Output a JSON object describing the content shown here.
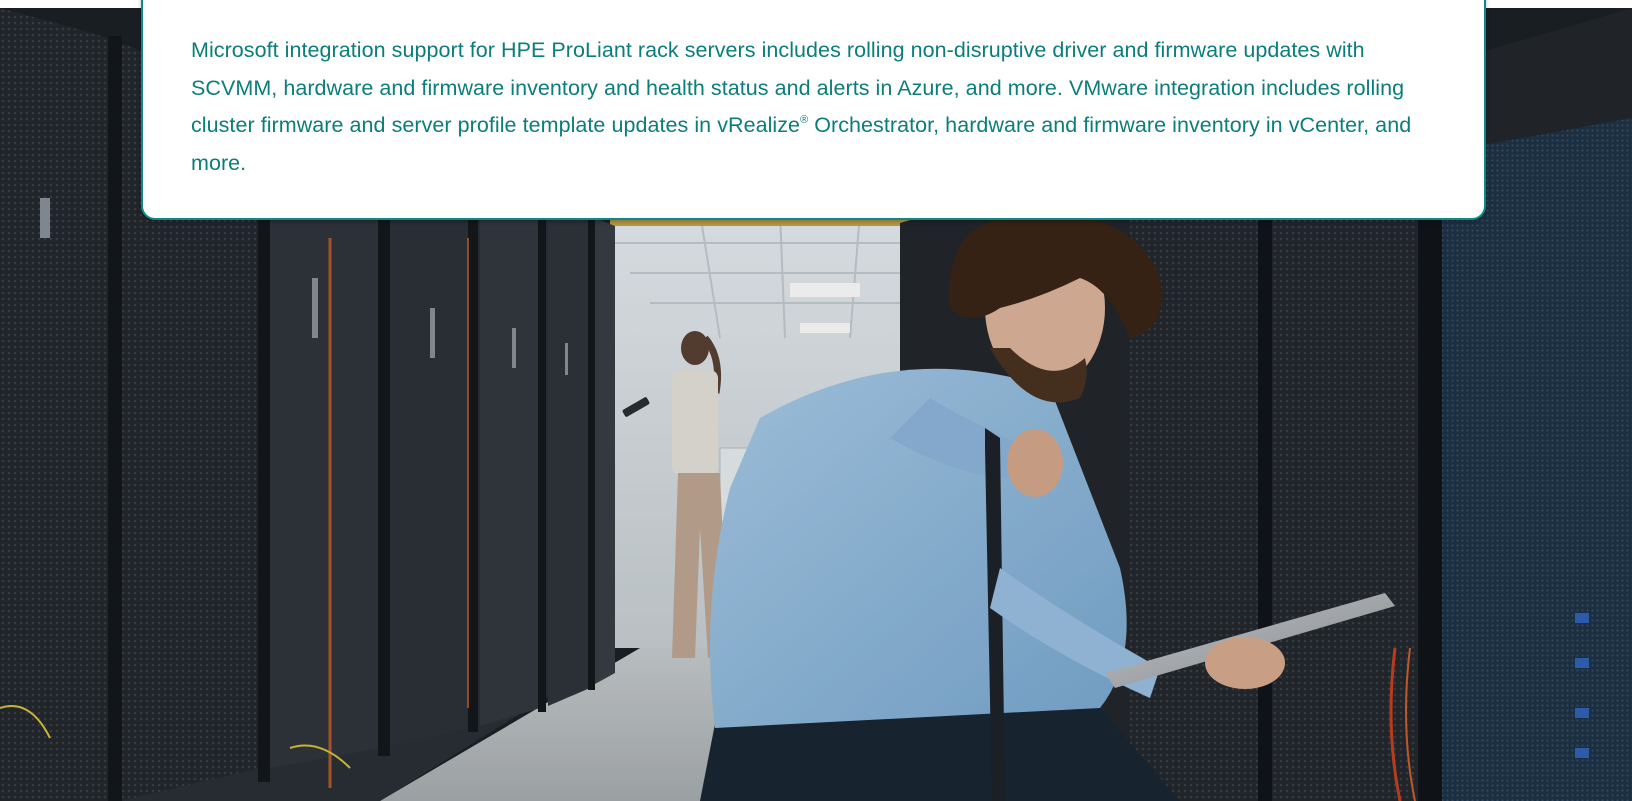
{
  "card": {
    "paragraph_part1": "Microsoft integration support for HPE ProLiant rack servers includes rolling non-disruptive driver and firmware updates with SCVMM, hardware and firmware inventory and health status and alerts in Azure, and more. VMware integration includes rolling cluster firmware and server profile template updates in vRealize",
    "registered_mark": "®",
    "paragraph_part2": " Orchestrator, hardware and firmware inventory in vCenter, and more."
  },
  "colors": {
    "accent_text": "#0b7d7a",
    "card_border": "#0e8a86"
  }
}
